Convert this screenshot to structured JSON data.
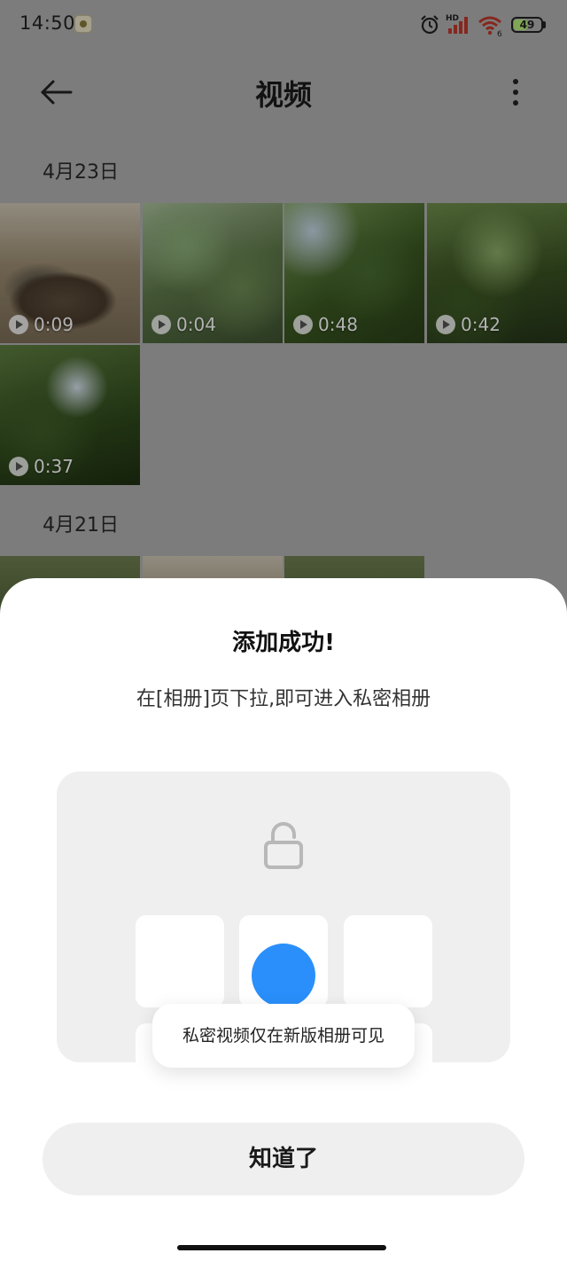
{
  "status_bar": {
    "time": "14:50",
    "battery": "49",
    "battery_level": 0.49,
    "icons": [
      "app-notification-icon",
      "alarm-clock-icon",
      "hd-signal-icon",
      "wifi-icon",
      "battery-icon"
    ]
  },
  "header": {
    "title": "视频",
    "back_icon": "arrow-left-icon",
    "more_icon": "more-vertical-icon"
  },
  "sections": [
    {
      "date": "4月23日",
      "videos": [
        {
          "duration": "0:09"
        },
        {
          "duration": "0:04"
        },
        {
          "duration": "0:48"
        },
        {
          "duration": "0:42"
        },
        {
          "duration": "0:37"
        }
      ]
    },
    {
      "date": "4月21日",
      "videos": [
        {
          "duration": ""
        },
        {
          "duration": ""
        },
        {
          "duration": ""
        }
      ]
    }
  ],
  "dialog": {
    "title": "添加成功!",
    "subtitle": "在[相册]页下拉,即可进入私密相册",
    "tooltip": "私密视频仅在新版相册可见",
    "button": "知道了",
    "accent_color": "#2A8FFB"
  }
}
